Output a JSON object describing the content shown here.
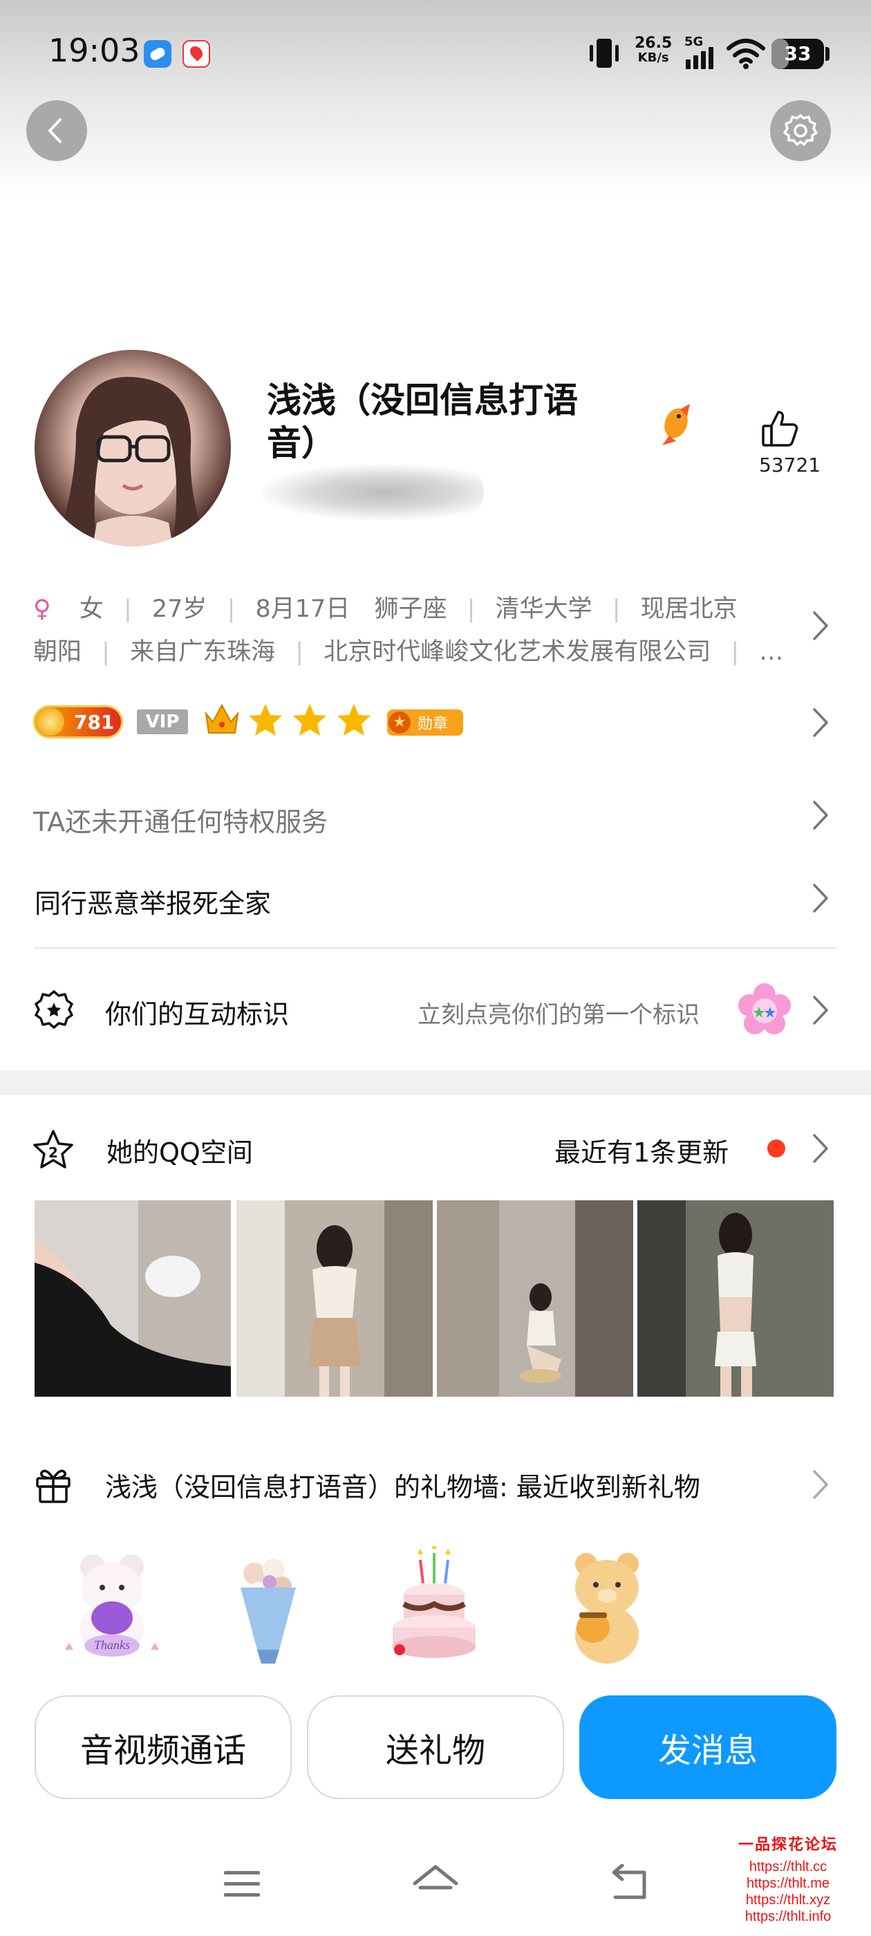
{
  "status_bar": {
    "time": "19:03",
    "net_speed_value": "26.5",
    "net_speed_unit": "KB/s",
    "network": "5G",
    "battery": "33",
    "battery_level": 0.33
  },
  "header": {
    "back_icon": "chevron-left-icon",
    "settings_icon": "gear-icon"
  },
  "profile": {
    "name": "浅浅（没回信息打语音）",
    "likes": "53721",
    "info_line1": [
      "女",
      "27岁",
      "8月17日",
      "狮子座",
      "清华大学",
      "现居北京"
    ],
    "info_line2": [
      "朝阳",
      "来自广东珠海",
      "北京时代峰峻文化艺术发展有限公司",
      "…"
    ]
  },
  "badges": {
    "level_number": "781",
    "vip_label": "VIP",
    "medal_label": "勋章",
    "stars": 3
  },
  "rows": {
    "privilege": "TA还未开通任何特权服务",
    "signature": "同行恶意举报死全家",
    "interaction_title": "你们的互动标识",
    "interaction_hint": "立刻点亮你们的第一个标识"
  },
  "qzone": {
    "title": "她的QQ空间",
    "update": "最近有1条更新"
  },
  "gift_wall": {
    "title": "浅浅（没回信息打语音）的礼物墙: 最近收到新礼物",
    "thanks_text": "Thanks"
  },
  "buttons": {
    "call": "音视频通话",
    "gift": "送礼物",
    "message": "发消息"
  },
  "watermark": {
    "title": "一品探花论坛",
    "links": [
      "https://thlt.cc",
      "https://thlt.me",
      "https://thlt.xyz",
      "https://thlt.info"
    ]
  },
  "colors": {
    "primary": "#0d99ff",
    "female": "#e05b9a",
    "update_dot": "#ff3b1f",
    "gold": "#f6a800"
  }
}
